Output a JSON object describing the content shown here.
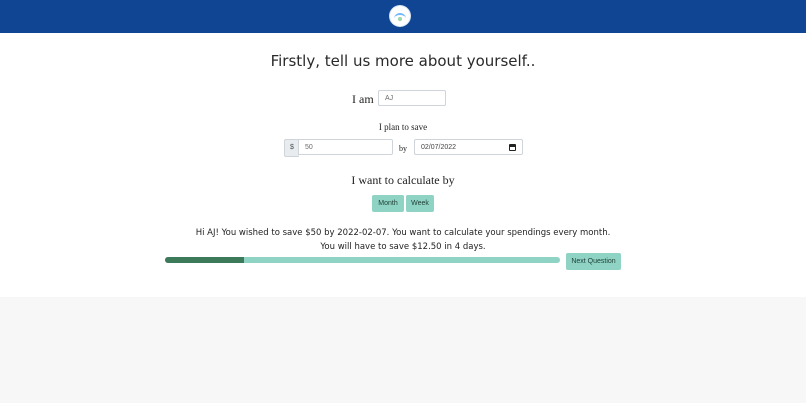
{
  "header": {
    "logo_icon": "circle-logo-icon"
  },
  "form": {
    "title": "Firstly, tell us more about yourself..",
    "iam_label": "I am",
    "name_value": "AJ",
    "plan_label": "I plan to save",
    "currency_symbol": "$",
    "amount_value": "50",
    "by_label": "by",
    "date_value": "02/07/2022",
    "calculate_by_label": "I want to calculate by",
    "buttons": {
      "month": "Month",
      "week": "Week",
      "next": "Next Question"
    }
  },
  "summary": {
    "line1": "Hi AJ! You wished to save $50 by 2022-02-07. You want to calculate your spendings every month.",
    "line2": "You will have to save $12.50 in 4 days."
  },
  "progress": {
    "percent": 20
  },
  "colors": {
    "header_bg": "#0f4592",
    "accent": "#8ed3c3",
    "progress_fill": "#3c7a5a"
  }
}
